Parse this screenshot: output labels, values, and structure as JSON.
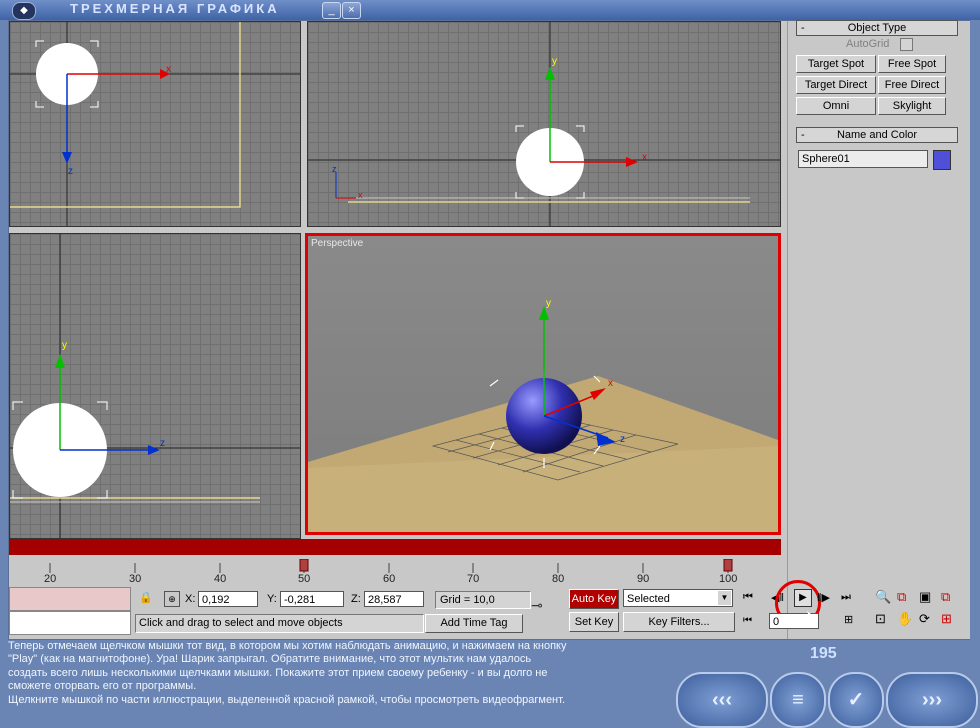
{
  "window": {
    "title": "ТРЕХМЕРНАЯ ГРАФИКА",
    "minimize": "_",
    "close": "×"
  },
  "viewports": {
    "active_label": "Perspective",
    "axis_x": "x",
    "axis_y": "y",
    "axis_z": "z"
  },
  "command_panel": {
    "object_type": {
      "header": "Object Type",
      "autogrid": "AutoGrid",
      "buttons": [
        "Target Spot",
        "Free Spot",
        "Target Direct",
        "Free Direct",
        "Omni",
        "Skylight"
      ]
    },
    "name_color": {
      "header": "Name and Color",
      "name_value": "Sphere01",
      "color": "#4f4fd8"
    }
  },
  "timeline": {
    "ticks": [
      "20",
      "30",
      "40",
      "50",
      "60",
      "70",
      "80",
      "90",
      "100"
    ],
    "current_frame": "0"
  },
  "status": {
    "x_label": "X:",
    "x_value": "0,192",
    "y_label": "Y:",
    "y_value": "-0,281",
    "z_label": "Z:",
    "z_value": "28,587",
    "grid": "Grid = 10,0",
    "prompt": "Click and drag to select and move objects",
    "add_time_tag": "Add Time Tag",
    "auto_key": "Auto Key",
    "selected": "Selected",
    "set_key": "Set Key",
    "key_filters": "Key Filters..."
  },
  "instructions": {
    "lines": [
      "Теперь отмечаем щелчком мышки тот вид, в котором мы хотим наблюдать анимацию, и нажимаем на кнопку",
      "\"Play\" (как на магнитофоне). Ура! Шарик запрыгал. Обратите внимание, что этот мультик нам удалось",
      "создать всего лишь несколькими щелчками мышки. Покажите этот прием своему ребенку - и вы долго не",
      "сможете оторвать его от программы.",
      "Щелкните мышкой по части иллюстрации, выделенной красной рамкой, чтобы просмотреть видеофрагмент."
    ]
  },
  "page_number": "195",
  "nav": {
    "back": "‹‹‹",
    "menu": "≡",
    "check": "✓",
    "forward": "›››"
  },
  "colors": {
    "accent_red": "#e00000",
    "title_bg": "#4a6db0",
    "sphere": "#4848c0"
  }
}
